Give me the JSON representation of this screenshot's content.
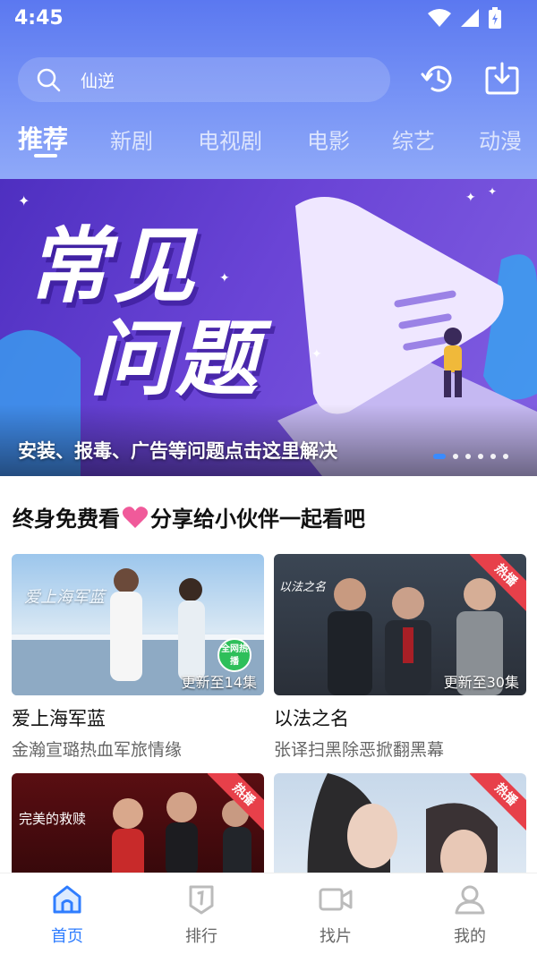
{
  "status": {
    "time": "4:45"
  },
  "search": {
    "query": "仙逆"
  },
  "tabs": [
    "推荐",
    "新剧",
    "电视剧",
    "电影",
    "综艺",
    "动漫"
  ],
  "banner": {
    "title_line1": "常见",
    "title_line2": "问题",
    "caption": "安装、报毒、广告等问题点击这里解决",
    "slide_count": 6,
    "active_slide": 0
  },
  "share": {
    "text_before": "终身免费看",
    "text_after": "分享给小伙伴一起看吧"
  },
  "cards": [
    {
      "title": "爱上海军蓝",
      "subtitle": "金瀚宣璐热血军旅情缘",
      "episodes": "更新至14集",
      "hot": "",
      "poster_text": "爱上海军蓝",
      "badge": "全网热播"
    },
    {
      "title": "以法之名",
      "subtitle": "张译扫黑除恶掀翻黑幕",
      "episodes": "更新至30集",
      "hot": "热播",
      "poster_text": "以法之名"
    },
    {
      "title": "",
      "subtitle": "",
      "episodes": "",
      "hot": "热播",
      "poster_text": "完美的救赎"
    },
    {
      "title": "",
      "subtitle": "",
      "episodes": "",
      "hot": "热播",
      "poster_text": ""
    }
  ],
  "bottom_nav": [
    {
      "label": "首页",
      "icon": "home-icon",
      "active": true
    },
    {
      "label": "排行",
      "icon": "ranking-icon",
      "active": false
    },
    {
      "label": "找片",
      "icon": "video-camera-icon",
      "active": false
    },
    {
      "label": "我的",
      "icon": "user-icon",
      "active": false
    }
  ],
  "colors": {
    "accent": "#2f7dff",
    "header": "#6a88f3",
    "hot": "#e7404a",
    "heart": "#f05a9a"
  }
}
